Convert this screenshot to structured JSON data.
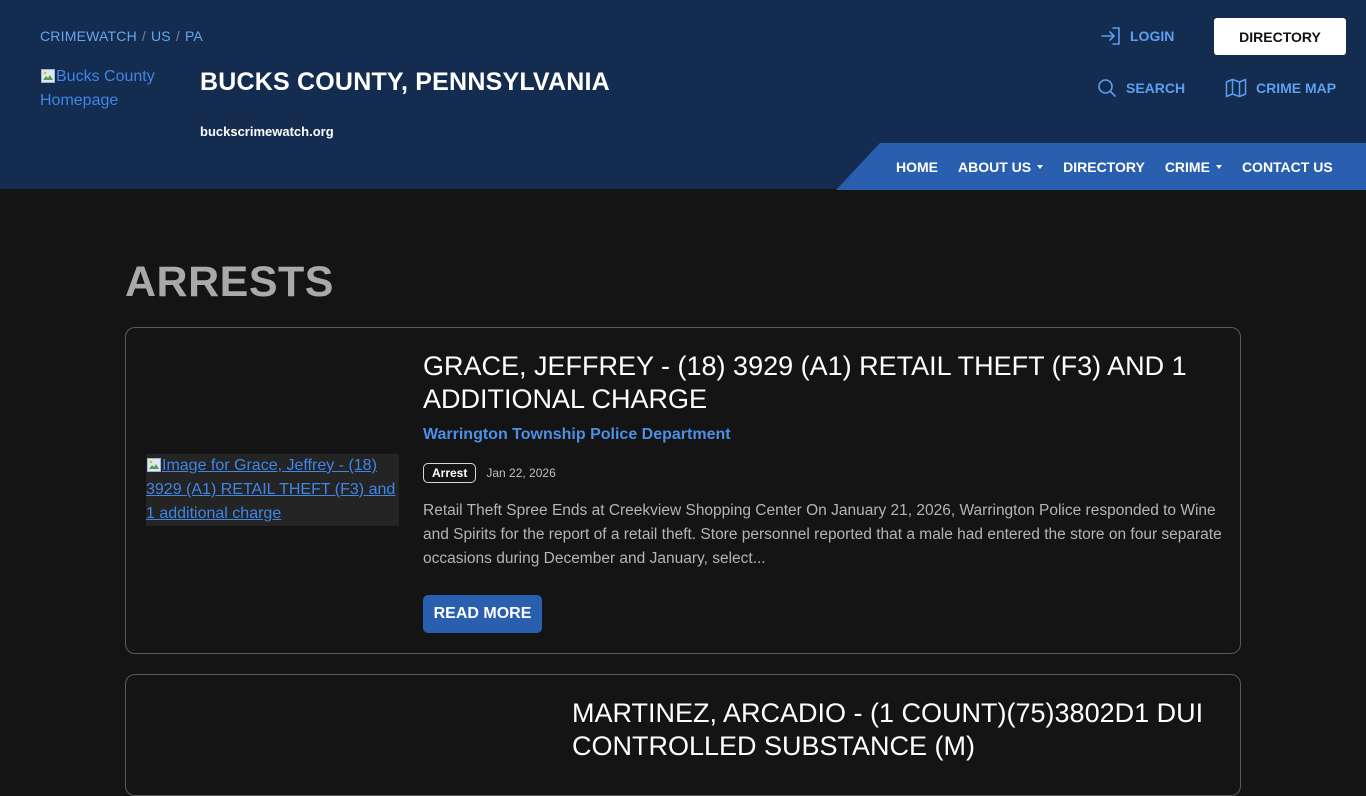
{
  "header": {
    "breadcrumb": [
      "CRIMEWATCH",
      "US",
      "PA"
    ],
    "logo_alt": "Bucks County Homepage",
    "site_title": "BUCKS COUNTY, PENNSYLVANIA",
    "site_url": "buckscrimewatch.org",
    "login_label": "LOGIN",
    "directory_button": "DIRECTORY",
    "search_label": "SEARCH",
    "crime_map_label": "CRIME MAP"
  },
  "nav": {
    "items": [
      {
        "label": "HOME",
        "dropdown": false
      },
      {
        "label": "ABOUT US",
        "dropdown": true
      },
      {
        "label": "DIRECTORY",
        "dropdown": false
      },
      {
        "label": "CRIME",
        "dropdown": true
      },
      {
        "label": "CONTACT US",
        "dropdown": false
      }
    ]
  },
  "page": {
    "title": "ARRESTS"
  },
  "posts": [
    {
      "image_alt": "Image for Grace, Jeffrey - (18) 3929 (A1) RETAIL THEFT (F3) and 1 additional charge",
      "title": "GRACE, JEFFREY - (18) 3929 (A1) RETAIL THEFT (F3) AND 1 ADDITIONAL CHARGE",
      "agency": "Warrington Township Police Department",
      "badge": "Arrest",
      "date": "Jan 22, 2026",
      "excerpt": "Retail Theft Spree Ends at Creekview Shopping Center On January 21, 2026, Warrington Police responded to Wine and Spirits for the report of a retail theft. Store personnel reported that a male had entered the store on four separate occasions during December and January, select...",
      "read_more": "READ MORE"
    },
    {
      "title": "MARTINEZ, ARCADIO - (1 COUNT)(75)3802D1 DUI CONTROLLED SUBSTANCE (M)"
    }
  ],
  "colors": {
    "header_bg": "#142c4f",
    "accent_blue": "#2a5fb0",
    "link_blue": "#5c9ef0",
    "page_bg": "#141414"
  }
}
